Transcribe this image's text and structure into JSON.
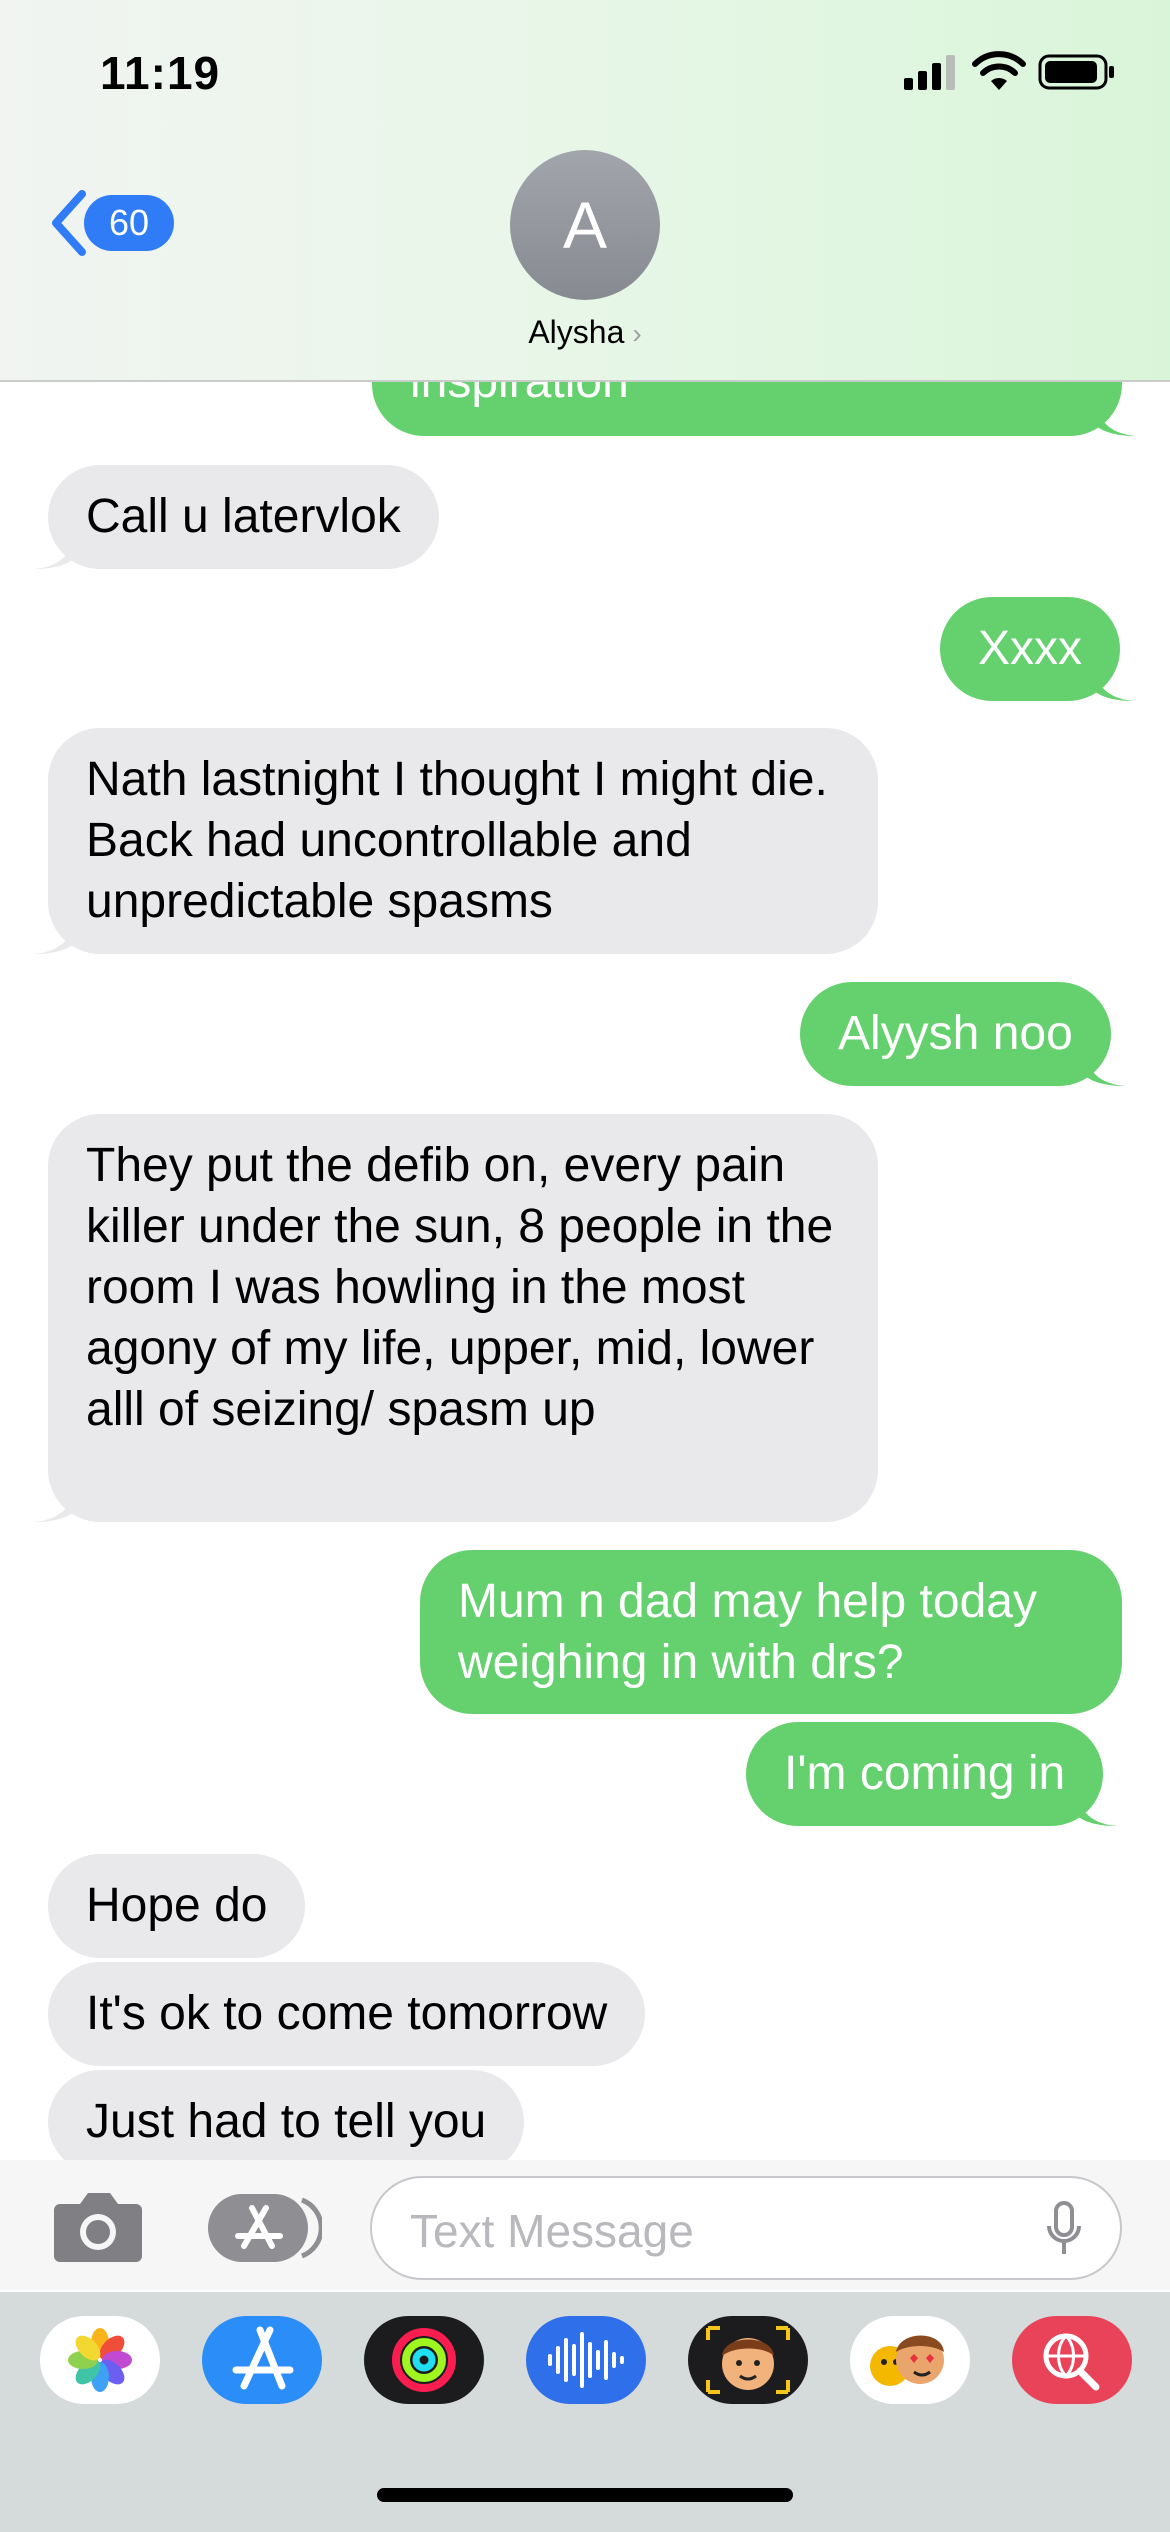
{
  "status_bar": {
    "time": "11:19"
  },
  "header": {
    "back_count": "60",
    "avatar_initial": "A",
    "contact_name": "Alysha",
    "chevron": "›"
  },
  "messages": [
    {
      "from": "me",
      "text": "inspiration"
    },
    {
      "from": "them",
      "text": "Call u latervlok"
    },
    {
      "from": "me",
      "text": "Xxxx"
    },
    {
      "from": "them",
      "text": "Nath lastnight I thought I might die. Back had uncontrollable and unpredictable spasms"
    },
    {
      "from": "me",
      "text": "Alyysh noo"
    },
    {
      "from": "them",
      "text": "They put the defib on, every pain killer under the sun, 8 people in the room I was howling in the most agony of my life, upper, mid, lower alll of seizing/ spasm up"
    },
    {
      "from": "me",
      "text": "Mum n dad may help today weighing in with drs?"
    },
    {
      "from": "me",
      "text": "I'm coming in"
    },
    {
      "from": "them",
      "text": "Hope do"
    },
    {
      "from": "them",
      "text": "It's ok to come tomorrow"
    },
    {
      "from": "them",
      "text": "Just had to tell you"
    }
  ],
  "input": {
    "placeholder": "Text Message"
  },
  "apps": [
    "photos-app",
    "app-store-app",
    "activity-app",
    "voice-memos-app",
    "memoji-app",
    "animoji-stickers-app",
    "web-search-app"
  ],
  "colors": {
    "sent": "#65d16e",
    "received": "#e9e9eb",
    "accent": "#2f7cf6"
  }
}
